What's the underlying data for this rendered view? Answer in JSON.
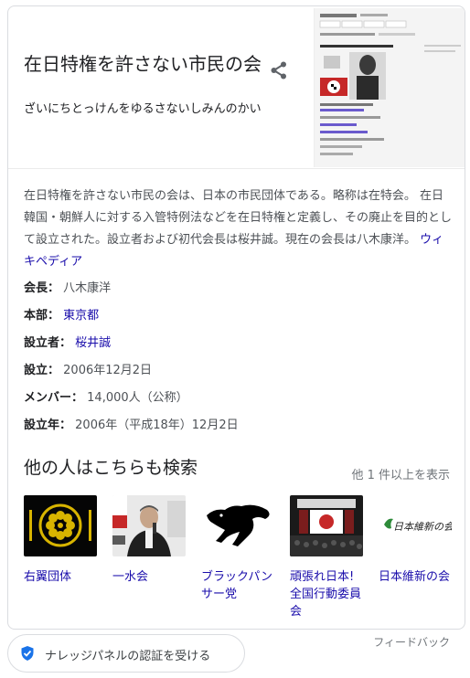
{
  "header": {
    "title": "在日特権を許さない市民の会",
    "subtitle": "ざいにちとっけんをゆるさないしみんのかい",
    "share_icon": "share-icon"
  },
  "description": {
    "text": "在日特権を許さない市民の会は、日本の市民団体である。略称は在特会。 在日韓国・朝鮮人に対する入管特例法などを在日特権と定義し、その廃止を目的として設立された。設立者および初代会長は桜井誠。現在の会長は八木康洋。",
    "source_link": "ウィキペディア"
  },
  "facts": [
    {
      "key": "会長：",
      "value": "八木康洋",
      "link": false
    },
    {
      "key": "本部：",
      "value": "東京都",
      "link": true
    },
    {
      "key": "設立者：",
      "value": "桜井誠",
      "link": true
    },
    {
      "key": "設立：",
      "value": "2006年12月2日",
      "link": false
    },
    {
      "key": "メンバー：",
      "value": "14,000人（公称）",
      "link": false
    },
    {
      "key": "設立年：",
      "value": "2006年（平成18年）12月2日",
      "link": false
    }
  ],
  "related": {
    "title": "他の人はこちらも検索",
    "more": "他 1 件以上を表示",
    "items": [
      {
        "label": "右翼団体"
      },
      {
        "label": "一水会"
      },
      {
        "label": "ブラックパンサー党"
      },
      {
        "label": "頑張れ日本!全国行動委員会"
      },
      {
        "label": "日本維新の会",
        "logo_text": "日本維新の会"
      }
    ]
  },
  "footer": {
    "feedback": "フィードバック",
    "claim": "ナレッジパネルの認証を受ける"
  },
  "colors": {
    "link": "#1a0dab",
    "text": "#202124",
    "muted": "#70757a",
    "verify": "#1a73e8"
  }
}
